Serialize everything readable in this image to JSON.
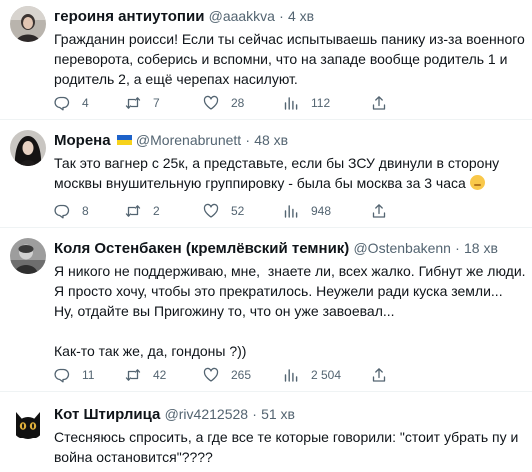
{
  "tweets": [
    {
      "name": "героиня антиутопии",
      "handle": "@aaakkva",
      "time": "4 хв",
      "lines": [
        "Гражданин роисси! Если ты сейчас испытываешь панику из-за военного",
        "переворота, соберись и вспомни, что на западе вообще родитель 1 и",
        "родитель 2, а ещё черепах насилуют."
      ],
      "replies": "4",
      "retweets": "7",
      "likes": "28",
      "views": "112"
    },
    {
      "name": "Морена",
      "handle": "@Morenabrunett",
      "time": "48 хв",
      "lines": [
        "Так это вагнер с 25к, а представьте, если бы ЗСУ двинули в сторону",
        "москвы внушительную группировку - была бы москва за 3 часа"
      ],
      "replies": "8",
      "retweets": "2",
      "likes": "52",
      "views": "948"
    },
    {
      "name": "Коля Остенбакен (кремлёвский темник)",
      "handle": "@Ostenbakenn",
      "time": "18 хв",
      "lines": [
        "Я никого не поддерживаю, мне,  знаете ли, всех жалко. Гибнут же люди.",
        "Я просто хочу, чтобы это прекратилось. Неужели ради куска земли...",
        "Ну, отдайте вы Пригожину то, что он уже завоевал..."
      ],
      "lines_after_gap": [
        "Как-то так же, да, гондоны ?))"
      ],
      "replies": "11",
      "retweets": "42",
      "likes": "265",
      "views": "2 504"
    },
    {
      "name": "Кот Штирлица",
      "handle": "@riv4212528",
      "time": "51 хв",
      "lines": [
        "Стесняюсь спросить, а где все те которые говорили: \"стоит убрать пу и",
        "война остановится\"????"
      ]
    }
  ],
  "separator": "·",
  "icons": {
    "reply": "reply-icon",
    "retweet": "retweet-icon",
    "like": "heart-icon",
    "views": "views-chart-icon",
    "share": "share-icon",
    "flag": "ukraine-flag-icon",
    "emoji": "face-with-hand-over-mouth-emoji"
  },
  "colors": {
    "text": "#0f1419",
    "secondary": "#536471",
    "divider": "#eff3f4",
    "flag_blue": "#1d62c9",
    "flag_yellow": "#f7d21b"
  }
}
